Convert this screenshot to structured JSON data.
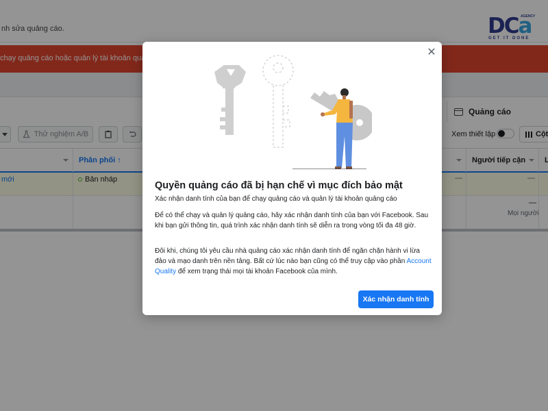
{
  "header": {
    "partial_text": "nh sửa quảng cáo.",
    "logo": {
      "main": "DC",
      "accent": "a",
      "agency": "AGENCY",
      "tagline": "GET IT DONE"
    }
  },
  "alert": {
    "text": "chạy quảng cáo hoặc quản lý tài khoản quảng",
    "color": "#e0452f"
  },
  "tabs": {
    "ads_label": "Quảng cáo",
    "ads_icon": "ad-page-icon"
  },
  "toolbar": {
    "ab_test_label": "Thử nghiệm A/B",
    "ab_test_icon": "flask-icon",
    "clipboard_icon": "clipboard-icon",
    "undo_icon": "undo-icon",
    "view_setup_label": "Xem thiết lập",
    "columns_label": "Cột",
    "columns_icon": "columns-icon"
  },
  "table": {
    "headers": {
      "delivery": "Phân phối ↑",
      "reach": "Người tiếp cận",
      "last_col": "L"
    },
    "rows": [
      {
        "name": "mới",
        "status": "Bản nháp",
        "reach": "—",
        "dash_mid": "—"
      },
      {
        "reach": "—",
        "reach_note": "Mọi người"
      }
    ]
  },
  "modal": {
    "title": "Quyền quảng cáo đã bị hạn chế vì mục đích bảo mật",
    "subtitle": "Xác nhận danh tính của bạn để chạy quảng cáo và quản lý tài khoản quảng cáo",
    "paragraph1": "Để có thể chạy và quản lý quảng cáo, hãy xác nhận danh tính của bạn với Facebook. Sau khi bạn gửi thông tin, quá trình xác nhận danh tính sẽ diễn ra trong vòng tối đa 48 giờ.",
    "paragraph2_before": "Đôi khi, chúng tôi yêu cầu nhà quảng cáo xác nhận danh tính để ngăn chặn hành vi lừa đảo và mạo danh trên nền tảng. Bất cứ lúc nào bạn cũng có thể truy cập vào phần ",
    "paragraph2_link": "Account Quality",
    "paragraph2_after": " để xem trạng thái mọi tài khoản Facebook của mình.",
    "confirm_button": "Xác nhận danh tính",
    "close_icon": "close-icon",
    "illustration": "person-holding-key-illustration"
  },
  "colors": {
    "primary": "#1877f2",
    "alert": "#e0452f",
    "draft_dot": "#42b72a"
  }
}
